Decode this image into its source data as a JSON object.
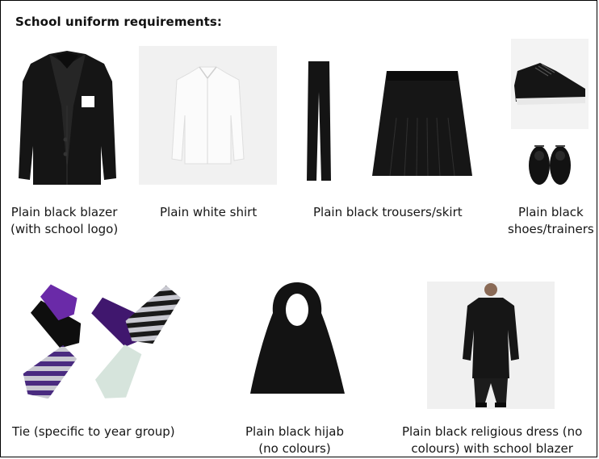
{
  "title": "School uniform requirements:",
  "items": [
    {
      "id": "blazer",
      "lines": [
        "Plain black blazer",
        "(with school logo)"
      ]
    },
    {
      "id": "shirt",
      "lines": [
        "Plain white shirt"
      ]
    },
    {
      "id": "trousers-skirt",
      "lines": [
        "Plain black trousers/skirt"
      ]
    },
    {
      "id": "shoes",
      "lines": [
        "Plain black",
        "shoes/trainers"
      ]
    },
    {
      "id": "tie",
      "lines": [
        "Tie (specific to year group)"
      ]
    },
    {
      "id": "hijab",
      "lines": [
        "Plain black hijab",
        "(no colours)"
      ]
    },
    {
      "id": "religious-dress",
      "lines": [
        "Plain black religious dress (no",
        "colours) with school blazer"
      ]
    }
  ],
  "colors": {
    "garment_black": "#141414",
    "shirt_white": "#f4f4f4",
    "tie_purple": "#4a1a78",
    "tie_stripe_grey": "#c8c8d0",
    "tie_mint": "#d6e4dc",
    "photo_bg": "#f1f1f1"
  }
}
